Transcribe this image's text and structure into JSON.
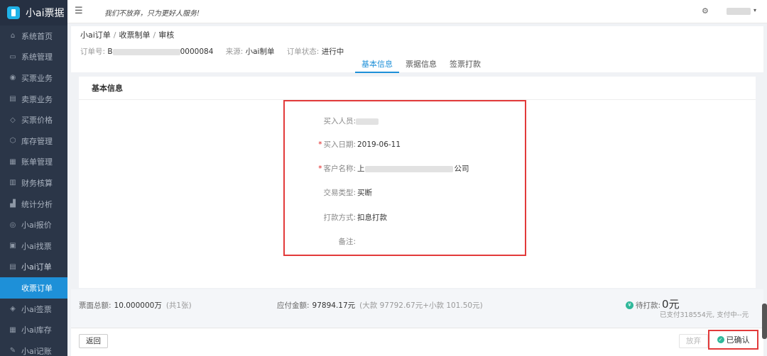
{
  "sidebar": {
    "app_name": "小ai票据",
    "items": [
      {
        "label": "系统首页",
        "icon": "home-icon",
        "glyph": "⌂"
      },
      {
        "label": "系统管理",
        "icon": "monitor-icon",
        "glyph": "▭"
      },
      {
        "label": "买票业务",
        "icon": "circle-icon",
        "glyph": "◉"
      },
      {
        "label": "卖票业务",
        "icon": "card-icon",
        "glyph": "▤"
      },
      {
        "label": "买票价格",
        "icon": "tag-icon",
        "glyph": "◇"
      },
      {
        "label": "库存管理",
        "icon": "box-icon",
        "glyph": "⬡"
      },
      {
        "label": "账单管理",
        "icon": "bill-icon",
        "glyph": "▦"
      },
      {
        "label": "财务核算",
        "icon": "calculator-icon",
        "glyph": "▥"
      },
      {
        "label": "统计分析",
        "icon": "chart-icon",
        "glyph": "▟"
      },
      {
        "label": "小ai报价",
        "icon": "price-icon",
        "glyph": "◎"
      },
      {
        "label": "小ai找票",
        "icon": "search-doc-icon",
        "glyph": "▣"
      },
      {
        "label": "小ai订单",
        "icon": "order-icon",
        "glyph": "▤"
      }
    ],
    "active_sub": "收票订单",
    "after_items": [
      {
        "label": "小ai签票",
        "icon": "shield-icon",
        "glyph": "◈"
      },
      {
        "label": "小ai库存",
        "icon": "stock-icon",
        "glyph": "▦"
      },
      {
        "label": "小ai记账",
        "icon": "edit-icon",
        "glyph": "✎"
      }
    ]
  },
  "header": {
    "menu_icon": "☰",
    "slogan": "我们不放弃，只为更好人服务!",
    "settings_icon": "⚙",
    "user_caret": "▾"
  },
  "info": {
    "breadcrumb": [
      "小ai订单",
      "收票制单",
      "审核"
    ],
    "order_no_label": "订单号:",
    "order_no_prefix": "B",
    "order_no_suffix": "0000084",
    "source_label": "来源:",
    "source_value": "小ai制单",
    "status_label": "订单状态:",
    "status_value": "进行中",
    "tabs": [
      "基本信息",
      "票据信息",
      "签票打款"
    ],
    "active_tab": 0
  },
  "form": {
    "title": "基本信息",
    "buyer_label": "买入人员:",
    "date_label": "买入日期:",
    "date_value": "2019-06-11",
    "customer_label": "客户名称:",
    "customer_prefix": "上",
    "customer_suffix": "公司",
    "trade_type_label": "交易类型:",
    "trade_type_value": "买断",
    "payment_label": "打款方式:",
    "payment_value": "扣息打款",
    "remark_label": "备注:"
  },
  "summary": {
    "face_total_label": "票面总额:",
    "face_total_value": "10.000000万",
    "face_count": "(共1张)",
    "payable_label": "应付金额:",
    "payable_value": "97894.17元",
    "payable_detail": "(大款 97792.67元+小款 101.50元)",
    "due_label": "待打款:",
    "due_value": "0元",
    "paid_info": "已支付318554元,  支付中--元",
    "due_icon_glyph": "¥"
  },
  "footer": {
    "back_label": "返回",
    "abandon_label": "放弃",
    "confirm_label": "已确认",
    "check_glyph": "✓"
  },
  "colors": {
    "sidebar_bg": "#2b3648",
    "accent": "#1e90d8",
    "highlight_border": "#e23a3a",
    "success": "#2fb89a"
  }
}
